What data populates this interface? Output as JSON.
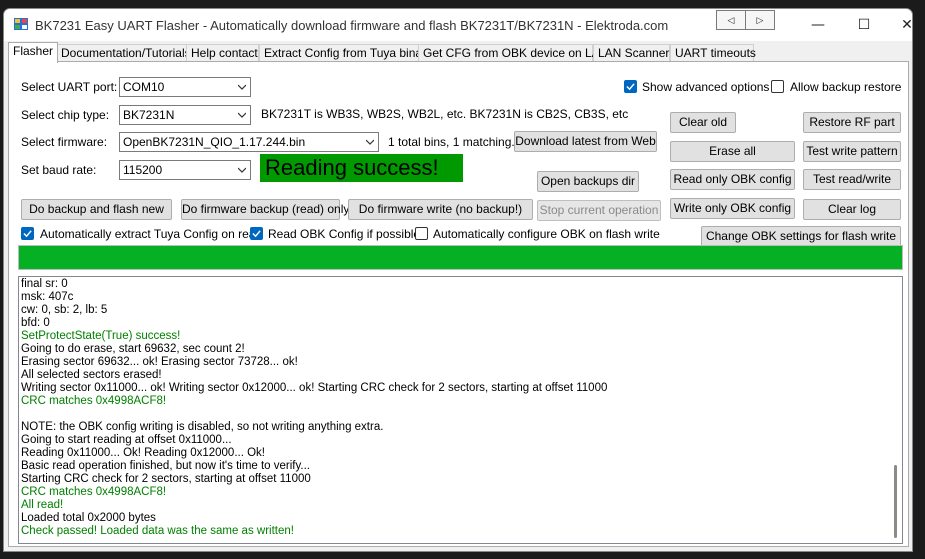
{
  "window": {
    "title": "BK7231 Easy UART Flasher - Automatically download firmware and flash BK7231T/BK7231N  - Elektroda.com",
    "nav_back": "◁",
    "nav_forward": "▷",
    "minimize": "—",
    "maximize": "☐",
    "close": "✕"
  },
  "tabs": [
    {
      "label": "Flasher"
    },
    {
      "label": "Documentation/Tutorials"
    },
    {
      "label": "Help contact"
    },
    {
      "label": "Extract Config from Tuya binary"
    },
    {
      "label": "Get CFG from OBK device on LAN"
    },
    {
      "label": "LAN Scanner"
    },
    {
      "label": "UART timeouts"
    }
  ],
  "form": {
    "uart_label": "Select UART port:",
    "uart_value": "COM10",
    "chip_label": "Select chip type:",
    "chip_value": "BK7231N",
    "chip_info": "BK7231T is WB3S, WB2S, WB2L, etc. BK7231N is CB2S, CB3S, etc",
    "firmware_label": "Select firmware:",
    "firmware_value": "OpenBK7231N_QIO_1.17.244.bin",
    "bins_info": "1 total bins, 1 matching.",
    "baud_label": "Set baud rate:",
    "baud_value": "115200",
    "status_text": "Reading success!",
    "status_color": "#009900"
  },
  "checkboxes": {
    "show_advanced": {
      "label": "Show advanced options",
      "checked": true
    },
    "allow_backup_restore": {
      "label": "Allow backup restore",
      "checked": false
    },
    "auto_extract_tuya": {
      "label": "Automatically extract Tuya Config on read",
      "checked": true
    },
    "read_obk_config": {
      "label": "Read OBK Config if possible",
      "checked": true
    },
    "auto_configure_obk": {
      "label": "Automatically configure OBK on flash write",
      "checked": false
    }
  },
  "buttons": {
    "download_latest": "Download latest from Web",
    "clear_old": "Clear old",
    "restore_rf": "Restore RF part",
    "erase_all": "Erase all",
    "test_write_pattern": "Test write pattern",
    "read_only_obk": "Read only OBK config",
    "test_read_write": "Test read/write",
    "open_backups": "Open backups dir",
    "write_only_obk": "Write only OBK config",
    "clear_log": "Clear log",
    "backup_and_flash": "Do backup and flash new",
    "firmware_backup": "Do firmware backup (read) only",
    "firmware_write": "Do firmware write (no backup!)",
    "stop_operation": "Stop current operation",
    "change_obk_settings": "Change OBK settings for flash write"
  },
  "progress": {
    "value_percent": 100,
    "color": "#06b025"
  },
  "log": [
    {
      "text": "final sr: 0",
      "color": "black"
    },
    {
      "text": "msk: 407c",
      "color": "black"
    },
    {
      "text": "cw: 0, sb: 2, lb: 5",
      "color": "black"
    },
    {
      "text": "bfd: 0",
      "color": "black"
    },
    {
      "text": "SetProtectState(True) success!",
      "color": "green"
    },
    {
      "text": "Going to do erase, start 69632, sec count 2!",
      "color": "black"
    },
    {
      "text": "Erasing sector 69632... ok! Erasing sector 73728... ok!",
      "color": "black"
    },
    {
      "text": "All selected sectors erased!",
      "color": "black"
    },
    {
      "text": "Writing sector 0x11000... ok! Writing sector 0x12000... ok! Starting CRC check for 2 sectors, starting at offset 11000",
      "color": "black"
    },
    {
      "text": "CRC matches 0x4998ACF8!",
      "color": "green"
    },
    {
      "text": "",
      "color": "black"
    },
    {
      "text": "NOTE: the OBK config writing is disabled, so not writing anything extra.",
      "color": "black"
    },
    {
      "text": "Going to start reading at offset 0x11000...",
      "color": "black"
    },
    {
      "text": "Reading 0x11000... Ok! Reading 0x12000... Ok!",
      "color": "black"
    },
    {
      "text": "Basic read operation finished, but now it's time to verify...",
      "color": "black"
    },
    {
      "text": "Starting CRC check for 2 sectors, starting at offset 11000",
      "color": "black"
    },
    {
      "text": "CRC matches 0x4998ACF8!",
      "color": "green"
    },
    {
      "text": "All read!",
      "color": "green"
    },
    {
      "text": "Loaded total 0x2000 bytes",
      "color": "black"
    },
    {
      "text": "Check passed! Loaded data was the same as written!",
      "color": "green"
    }
  ]
}
